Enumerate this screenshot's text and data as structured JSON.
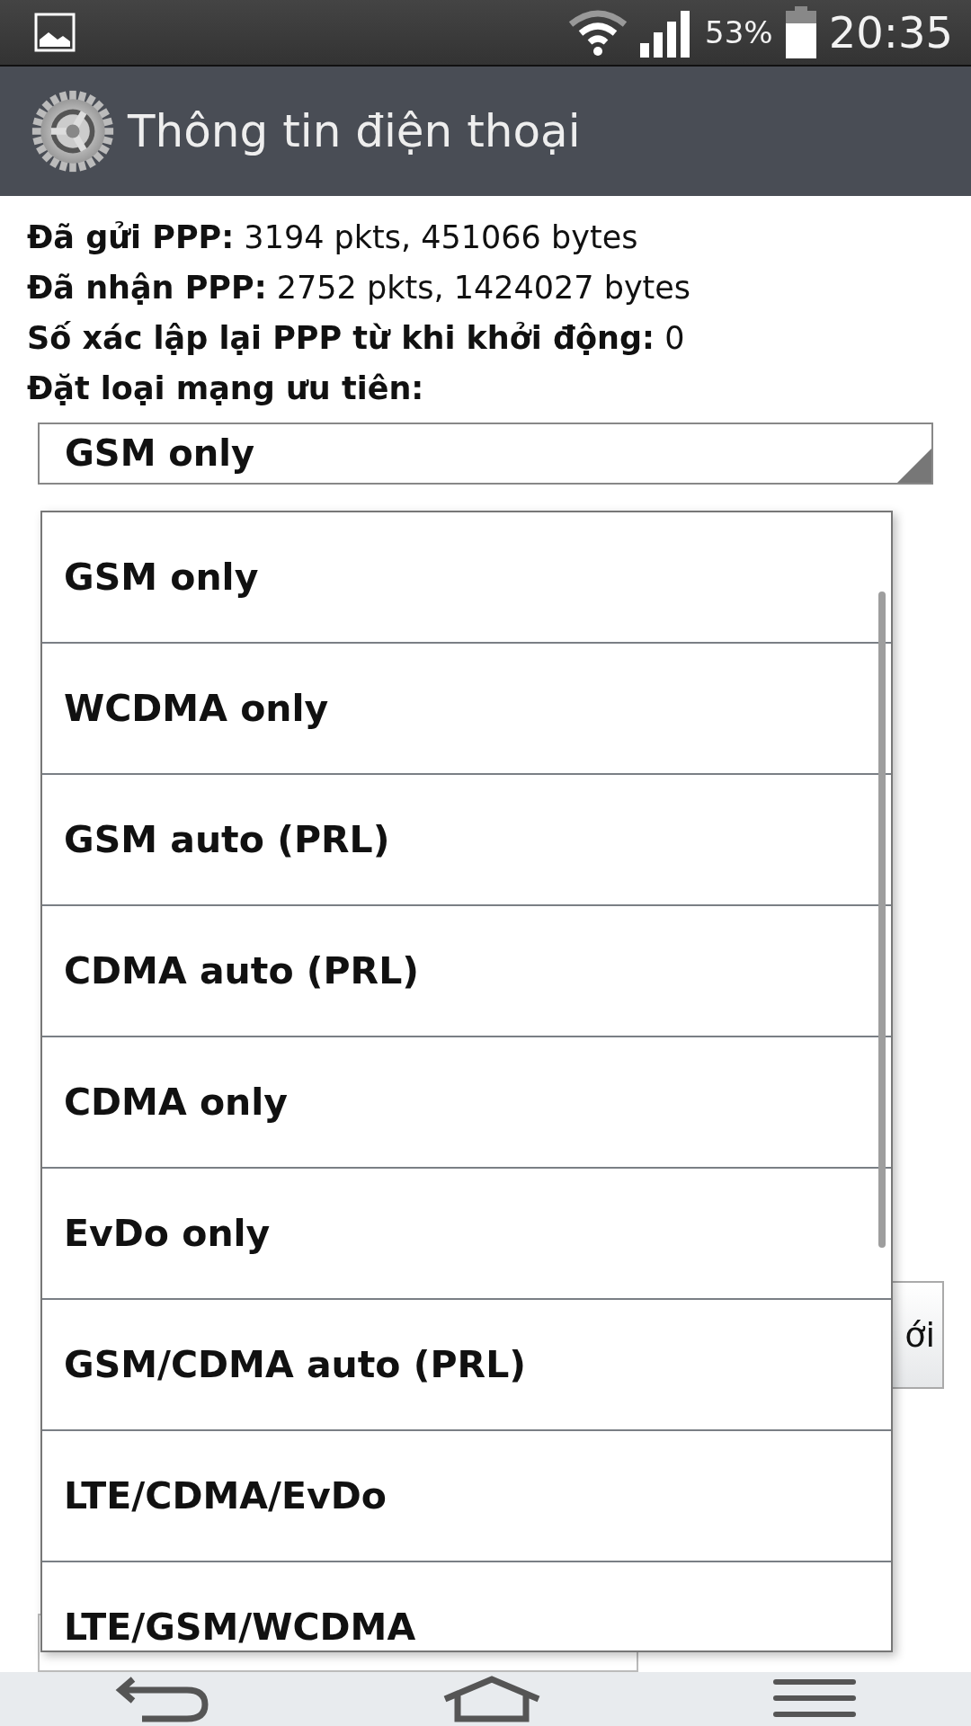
{
  "status_bar": {
    "battery": "53%",
    "time": "20:35"
  },
  "header": {
    "title": "Thông tin điện thoại"
  },
  "info_lines": [
    "**Đã gửi PPP:** 3194 pkts, 451066 bytes",
    "**Đã nhận PPP:** 2752 pkts, 1424027 bytes",
    "**Số xác lập lại PPP từ khi khởi động:** 0"
  ],
  "network_type": {
    "label": "Đặt loại mạng ưu tiên:",
    "value": "GSM only"
  },
  "dropdown": {
    "options": [
      "GSM only",
      "WCDMA only",
      "GSM auto (PRL)",
      "CDMA auto (PRL)",
      "CDMA only",
      "EvDo only",
      "GSM/CDMA auto (PRL)",
      "LTE/CDMA/EvDo",
      "LTE/GSM/WCDMA"
    ]
  },
  "covered": {
    "button_fragment": "ới"
  }
}
